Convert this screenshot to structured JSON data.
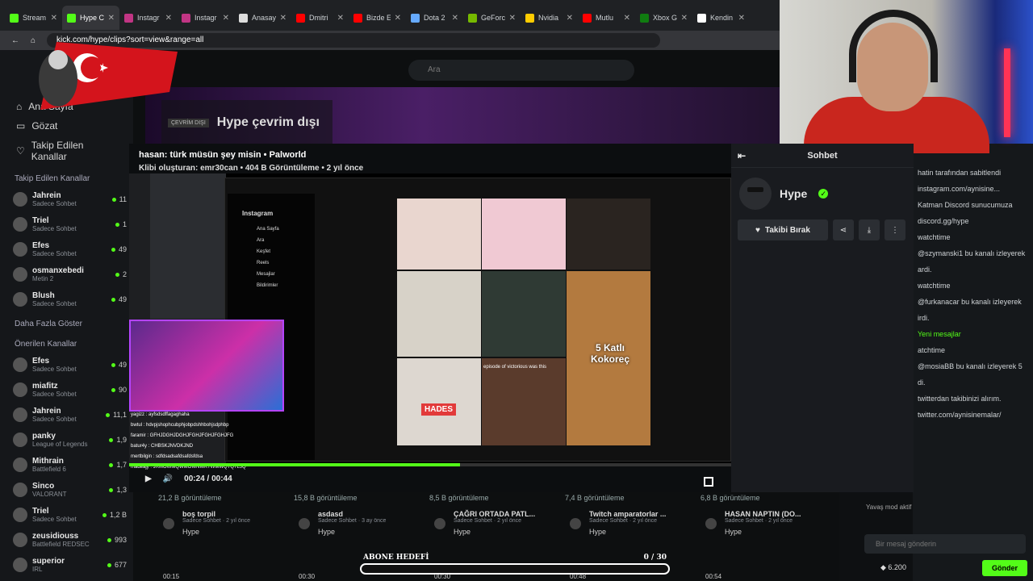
{
  "browser": {
    "tabs": [
      {
        "label": "Stream",
        "color": "#53fc18"
      },
      {
        "label": "Hype C",
        "color": "#53fc18"
      },
      {
        "label": "Instagr",
        "color": "#c13584"
      },
      {
        "label": "Instagr",
        "color": "#c13584"
      },
      {
        "label": "Anasay",
        "color": "#dddddd"
      },
      {
        "label": "Dmitri",
        "color": "#ff0000"
      },
      {
        "label": "Bizde E",
        "color": "#ff0000"
      },
      {
        "label": "Dota 2",
        "color": "#66aaff"
      },
      {
        "label": "GeForc",
        "color": "#76b900"
      },
      {
        "label": "Nvidia",
        "color": "#ffcc00"
      },
      {
        "label": "Mutlu",
        "color": "#ff0000"
      },
      {
        "label": "Xbox G",
        "color": "#107c10"
      },
      {
        "label": "Kendin",
        "color": "#ffffff"
      }
    ],
    "url": "kick.com/hype/clips?sort=view&range=all"
  },
  "kick": {
    "search_placeholder": "Ara",
    "nav": {
      "home": "Ana Sayfa",
      "browse": "Gözat",
      "following": "Takip Edilen Kanallar"
    },
    "followed_title": "Takip Edilen Kanallar",
    "followed": [
      {
        "name": "Jahrein",
        "sub": "Sadece Sohbet",
        "viewers": "11"
      },
      {
        "name": "Triel",
        "sub": "Sadece Sohbet",
        "viewers": "1"
      },
      {
        "name": "Efes",
        "sub": "Sadece Sohbet",
        "viewers": "49"
      },
      {
        "name": "osmanxebedi",
        "sub": "Metin 2",
        "viewers": "2"
      },
      {
        "name": "Blush",
        "sub": "Sadece Sohbet",
        "viewers": "49"
      }
    ],
    "show_more": "Daha Fazla Göster",
    "recommended_title": "Önerilen Kanallar",
    "recommended": [
      {
        "name": "Efes",
        "sub": "Sadece Sohbet",
        "viewers": "49"
      },
      {
        "name": "miafitz",
        "sub": "Sadece Sohbet",
        "viewers": "90"
      },
      {
        "name": "Jahrein",
        "sub": "Sadece Sohbet",
        "viewers": "11,1"
      },
      {
        "name": "panky",
        "sub": "League of Legends",
        "viewers": "1,9"
      },
      {
        "name": "Mithrain",
        "sub": "Battlefield 6",
        "viewers": "1,7"
      },
      {
        "name": "Sinco",
        "sub": "VALORANT",
        "viewers": "1,3"
      },
      {
        "name": "Triel",
        "sub": "Sadece Sohbet",
        "viewers": "1,2 B"
      },
      {
        "name": "zeusidiouss",
        "sub": "Battlefield REDSEC",
        "viewers": "993"
      },
      {
        "name": "superior",
        "sub": "IRL",
        "viewers": "677"
      }
    ],
    "offline_badge": "ÇEVRİM DIŞI",
    "offline_title": "Hype çevrim dışı",
    "clips": [
      {
        "views": "21,2 B görüntüleme",
        "title": "boş torpil",
        "sub": "Sadece Sohbet · 2 yıl önce",
        "channel": "Hype"
      },
      {
        "views": "15,8 B görüntüleme",
        "title": "asdasd",
        "sub": "Sadece Sohbet · 3 ay önce",
        "channel": "Hype"
      },
      {
        "views": "8,5 B görüntüleme",
        "title": "ÇAĞRI ORTADA PATL...",
        "sub": "Sadece Sohbet · 2 yıl önce",
        "channel": "Hype"
      },
      {
        "views": "7,4 B görüntüleme",
        "title": "Twitch amparatorlar ...",
        "sub": "Sadece Sohbet · 2 yıl önce",
        "channel": "Hype"
      },
      {
        "views": "6,8 B görüntüleme",
        "title": "HASAN NAPTIN (DO...",
        "sub": "Sadece Sohbet · 2 yıl önce",
        "channel": "Hype"
      }
    ],
    "durations": [
      "00:15",
      "00:30",
      "00:30",
      "00:48",
      "00:54"
    ]
  },
  "clip": {
    "title": "hasan: türk müsün şey misin • Palworld",
    "creator": "Klibi oluşturan: emr30can • 404 B Görüntüleme • 2 yıl önce",
    "time": "00:24 / 00:44",
    "progress": 0.55
  },
  "video_content": {
    "ig_label": "Instagram",
    "ig_nav": [
      "Ana Sayfa",
      "Ara",
      "Keşfet",
      "Reels",
      "Mesajlar",
      "Bildirimler"
    ],
    "tile_text": [
      "5 Katlı Kokoreç",
      "HADES",
      "episode of victorious was this"
    ],
    "chat_lines": [
      "yagizz : ayfsdsdffagaghaha",
      "bwtul : hdvpjshophcubphjobpdshhbohjsdphbp",
      "faramir : GFHJDGHJDGHJFGHJFGHJFGHJFG",
      "batur4y : CHBSKJNVDKJND",
      "mertbilgin : sdfdsadsafdsafdsfdsa",
      "madeajy : JRMOWMQWMOWNWKTWMWQTQTLJQ"
    ]
  },
  "chat_panel": {
    "title": "Sohbet",
    "channel": "Hype",
    "unfollow": "Takibi Bırak"
  },
  "bg_chat": {
    "lines": [
      "hatin tarafından sabitlendi",
      "instagram.com/aynisine...",
      "Katman Discord sunucumuza",
      "discord.gg/hype",
      "watchtime",
      "@szymanski1 bu kanalı izleyerek",
      "ardi.",
      "watchtime",
      "@furkanacar bu kanalı izleyerek",
      "irdi.",
      "Yeni mesajlar",
      "atchtime",
      "@mosiaBB bu kanalı izleyerek 5",
      "di.",
      "twitterdan takibinizi alırım.",
      "twitter.com/aynisinemalar/"
    ],
    "input_placeholder": "Bir mesaj gönderin",
    "points": "6.200",
    "send": "Gönder",
    "mod_active": "Yavaş mod aktif"
  },
  "goal": {
    "label": "ABONE HEDEFİ",
    "count": "0 / 30",
    "progress": 0
  }
}
